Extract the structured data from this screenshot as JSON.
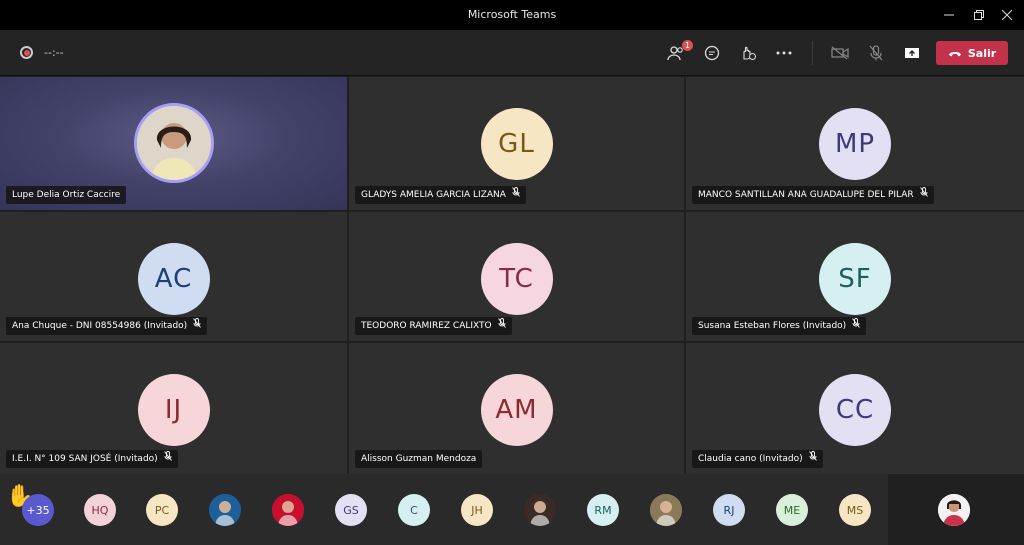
{
  "window": {
    "title": "Microsoft Teams"
  },
  "toolbar": {
    "timer": "--:--",
    "participants_badge": "1",
    "leave_label": "Salir"
  },
  "tiles": [
    {
      "name": "Lupe Delia Ortiz Caccire",
      "initials": "",
      "bg": "",
      "fg": "",
      "muted": false,
      "photo": true
    },
    {
      "name": "GLADYS AMELIA GARCIA LIZANA",
      "initials": "GL",
      "bg": "#f7e6c4",
      "fg": "#7a5a12",
      "muted": true
    },
    {
      "name": "MANCO SANTILLAN ANA GUADALUPE DEL PILAR",
      "initials": "MP",
      "bg": "#e3e0f3",
      "fg": "#3d3a77",
      "muted": true
    },
    {
      "name": "Ana Chuque - DNI 08554986 (Invitado)",
      "initials": "AC",
      "bg": "#cfdcf1",
      "fg": "#1c3f77",
      "muted": true
    },
    {
      "name": "TEODORO RAMIREZ CALIXTO",
      "initials": "TC",
      "bg": "#f6d7e1",
      "fg": "#8a2a47",
      "muted": true
    },
    {
      "name": "Susana Esteban Flores (Invitado)",
      "initials": "SF",
      "bg": "#d6eff0",
      "fg": "#1c5f61",
      "muted": true
    },
    {
      "name": "I.E.I. N° 109 SAN JOSÉ (Invitado)",
      "initials": "IJ",
      "bg": "#f6d6d8",
      "fg": "#8a2a33",
      "muted": true
    },
    {
      "name": "Alisson Guzman Mendoza",
      "initials": "AM",
      "bg": "#f6d6d8",
      "fg": "#8a2a33",
      "muted": false
    },
    {
      "name": "Claudia cano (Invitado)",
      "initials": "CC",
      "bg": "#e3e0f3",
      "fg": "#3d3a77",
      "muted": true
    }
  ],
  "strip": {
    "overflow": "+35",
    "people": [
      {
        "initials": "HQ",
        "bg": "#f1d2d6",
        "fg": "#8a2a47",
        "photo": false
      },
      {
        "initials": "PC",
        "bg": "#f7e6c4",
        "fg": "#7a5a12",
        "photo": false
      },
      {
        "initials": "",
        "bg": "#1d5f9a",
        "fg": "#fff",
        "photo": true
      },
      {
        "initials": "",
        "bg": "#c8102e",
        "fg": "#fff",
        "photo": true
      },
      {
        "initials": "GS",
        "bg": "#e3e0f3",
        "fg": "#3d3a77",
        "photo": false
      },
      {
        "initials": "C",
        "bg": "#d6eff0",
        "fg": "#1c5f61",
        "photo": false
      },
      {
        "initials": "JH",
        "bg": "#f7e6c4",
        "fg": "#7a5a12",
        "photo": false
      },
      {
        "initials": "",
        "bg": "#3a2b26",
        "fg": "#fff",
        "photo": true
      },
      {
        "initials": "RM",
        "bg": "#d6eff0",
        "fg": "#1c5f61",
        "photo": false
      },
      {
        "initials": "",
        "bg": "#8a7a5a",
        "fg": "#fff",
        "photo": true
      },
      {
        "initials": "RJ",
        "bg": "#cfdcf1",
        "fg": "#1c3f77",
        "photo": false
      },
      {
        "initials": "ME",
        "bg": "#d9efd9",
        "fg": "#2a6a2a",
        "photo": false
      },
      {
        "initials": "MS",
        "bg": "#f7e6c4",
        "fg": "#7a5a12",
        "photo": false
      }
    ]
  },
  "colors": {
    "accent": "#a99ef5",
    "leave": "#c4314b"
  }
}
